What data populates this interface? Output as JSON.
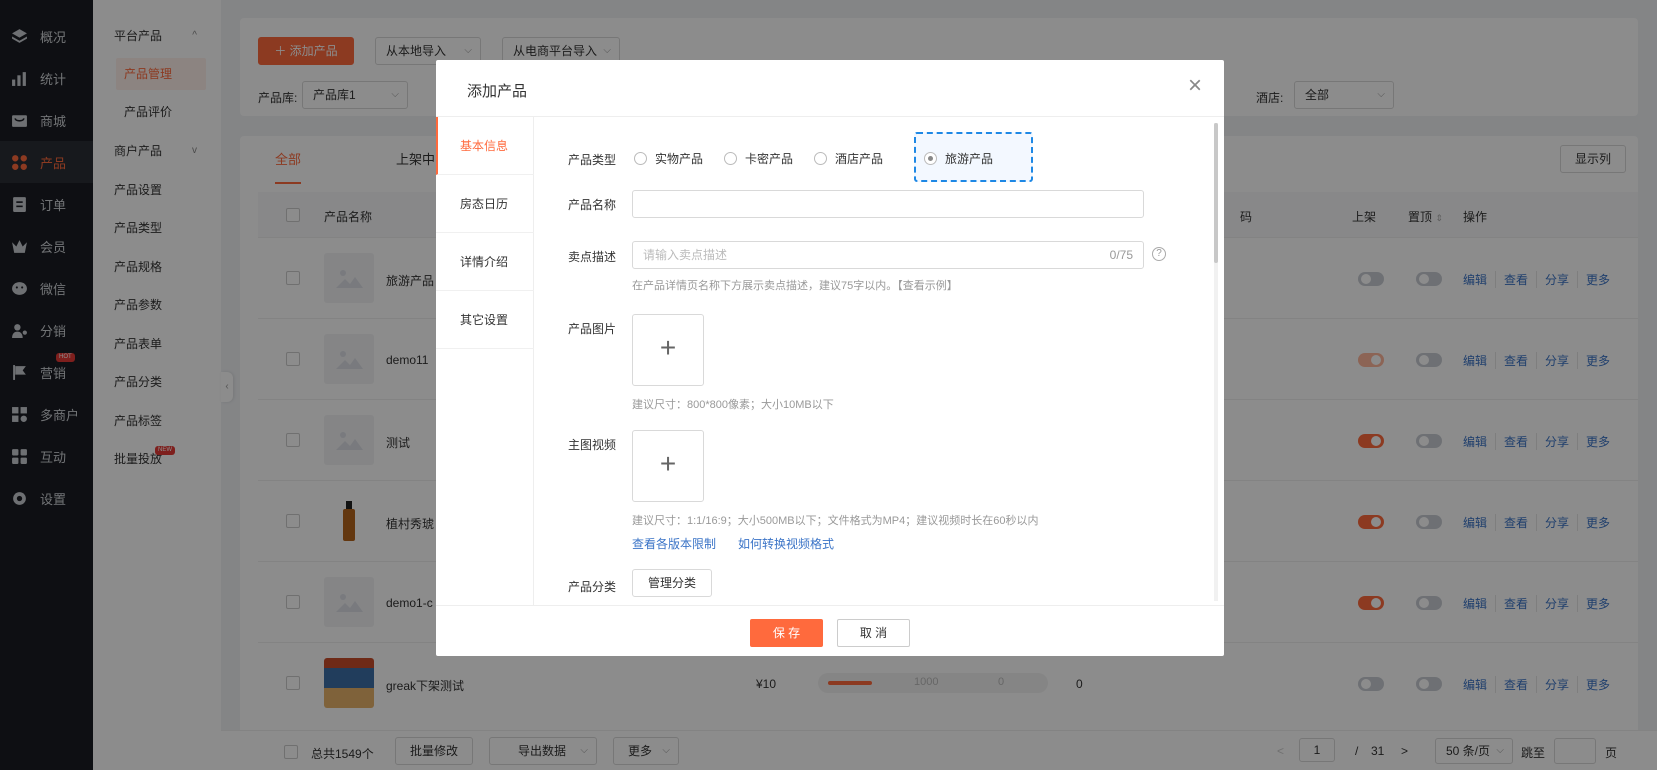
{
  "nav": [
    {
      "label": "概况",
      "icon": "layers-icon"
    },
    {
      "label": "统计",
      "icon": "chart-icon"
    },
    {
      "label": "商城",
      "icon": "store-icon"
    },
    {
      "label": "产品",
      "icon": "product-icon"
    },
    {
      "label": "订单",
      "icon": "order-icon"
    },
    {
      "label": "会员",
      "icon": "crown-icon"
    },
    {
      "label": "微信",
      "icon": "wechat-icon"
    },
    {
      "label": "分销",
      "icon": "distribution-icon"
    },
    {
      "label": "营销",
      "icon": "flag-icon",
      "badge": "HOT"
    },
    {
      "label": "多商户",
      "icon": "merchant-icon"
    },
    {
      "label": "互动",
      "icon": "interact-icon"
    },
    {
      "label": "设置",
      "icon": "gear-icon"
    }
  ],
  "subnav": [
    {
      "label": "平台产品",
      "chev": "^"
    },
    {
      "label": "产品管理"
    },
    {
      "label": "产品评价"
    },
    {
      "label": "商户产品",
      "chev": "v"
    },
    {
      "label": "产品设置"
    },
    {
      "label": "产品类型"
    },
    {
      "label": "产品规格"
    },
    {
      "label": "产品参数"
    },
    {
      "label": "产品表单"
    },
    {
      "label": "产品分类"
    },
    {
      "label": "产品标签"
    },
    {
      "label": "批量投放",
      "badge": "NEW"
    }
  ],
  "toolbar": {
    "add": "＋  添加产品",
    "import_local": "从本地导入",
    "import_ecom": "从电商平台导入",
    "lib_label": "产品库:",
    "lib_value": "产品库1",
    "hotel_label": "酒店:",
    "hotel_value": "全部"
  },
  "tabs": [
    "全部",
    "上架中"
  ],
  "show_columns": "显示列",
  "table": {
    "headers": {
      "name": "产品名称",
      "code": "码",
      "shelf": "上架",
      "top": "置顶",
      "ops": "操作"
    },
    "rows": [
      {
        "name": "旅游产品",
        "shelf": "off",
        "top": "off"
      },
      {
        "name": "demo11",
        "shelf": "half",
        "top": "off"
      },
      {
        "name": "测试",
        "shelf": "on",
        "top": "off"
      },
      {
        "name": "植村秀琥",
        "shelf": "on",
        "top": "off"
      },
      {
        "name": "demo1-c",
        "shelf": "on",
        "top": "off"
      },
      {
        "name": "greak下架测试",
        "price": "¥10",
        "stock": "1000",
        "sold": "0",
        "count": "0",
        "shelf": "off",
        "top": "off"
      }
    ],
    "actions": [
      "编辑",
      "查看",
      "分享",
      "更多"
    ]
  },
  "footer": {
    "total": "总共1549个",
    "batch": "批量修改",
    "export": "导出数据",
    "more": "更多",
    "prev": "<",
    "page": "1",
    "sep": "/",
    "pages": "31",
    "next": ">",
    "per_page": "50 条/页",
    "jump": "跳至",
    "page_unit": "页"
  },
  "modal": {
    "title": "添加产品",
    "close": "×",
    "side": [
      "基本信息",
      "房态日历",
      "详情介绍",
      "其它设置"
    ],
    "type_label": "产品类型",
    "types": [
      "实物产品",
      "卡密产品",
      "酒店产品",
      "旅游产品"
    ],
    "selected_type": "旅游产品",
    "name_label": "产品名称",
    "name_value": "",
    "desc_label": "卖点描述",
    "desc_placeholder": "请输入卖点描述",
    "desc_count": "0/75",
    "desc_hint": "在产品详情页名称下方展示卖点描述，建议75字以内。【查看示例】",
    "image_label": "产品图片",
    "image_hint": "建议尺寸：800*800像素；大小10MB以下",
    "video_label": "主图视频",
    "video_hint": "建议尺寸：1:1/16:9；大小500MB以下；文件格式为MP4；建议视频时长在60秒以内",
    "link1": "查看各版本限制",
    "link2": "如何转换视频格式",
    "category_label": "产品分类",
    "category_btn": "管理分类",
    "plus": "+",
    "save": "保 存",
    "cancel": "取 消"
  }
}
